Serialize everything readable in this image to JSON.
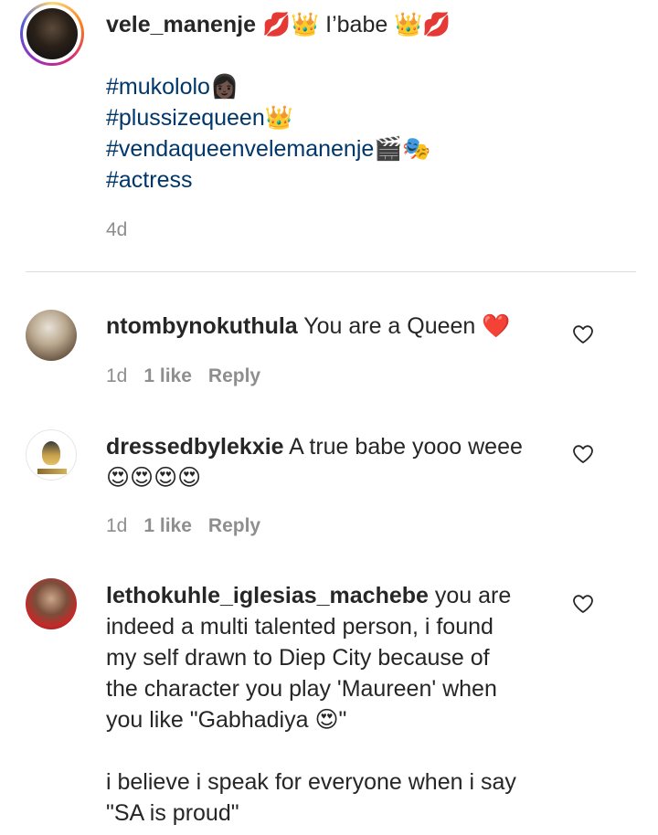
{
  "caption": {
    "username": "vele_manenje",
    "title_suffix": " 💋👑 I’babe 👑💋",
    "hashtags": [
      "#mukololo👩🏿",
      "#plussizequeen👑",
      "#vendaqueenvelemanenje🎬🎭",
      "#actress"
    ],
    "time": "4d"
  },
  "comments": [
    {
      "username": "ntombynokuthula",
      "text": " You are a Queen ❤️",
      "time": "1d",
      "likes": "1 like",
      "reply": "Reply"
    },
    {
      "username": "dressedbylekxie",
      "text": " A true babe yooo weee",
      "text2": "😍😍😍😍",
      "time": "1d",
      "likes": "1 like",
      "reply": "Reply"
    },
    {
      "username": "lethokuhle_iglesias_machebe",
      "text": " you are",
      "lines": [
        "indeed a multi talented person, i found",
        "my self drawn to Diep City because of",
        "the character you play 'Maureen' when",
        "you like \"Gabhadiya 😍\"",
        "",
        "i believe i speak for everyone when i say",
        "\"SA is proud\""
      ]
    }
  ],
  "icons": {
    "like": "heart-outline-icon"
  }
}
